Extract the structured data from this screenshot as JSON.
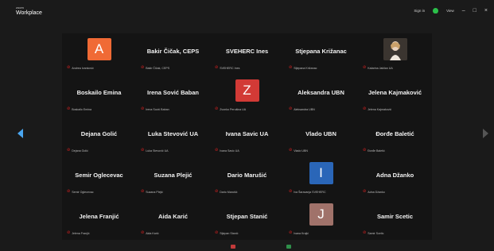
{
  "app": {
    "brand_small": "zoom",
    "brand_title": "Workplace"
  },
  "titlebar": {
    "sign_in_label": "Sign in",
    "view_label": "View",
    "minimize": "–",
    "maximize": "□",
    "close": "×",
    "shield_color": "#2bbf4a"
  },
  "participants": [
    {
      "name": "",
      "initial": "A",
      "avatar_color": "#f06a35",
      "footer": "Andrea Ivanković"
    },
    {
      "name": "Bakir Čičak, CEPS",
      "footer": "Bakir Čičak, CEPS"
    },
    {
      "name": "SVEHERC Ines",
      "footer": "SVEHERC Ines"
    },
    {
      "name": "Stjepana Križanac",
      "footer": "Stjepana Križanac"
    },
    {
      "name": "",
      "photo": true,
      "footer": "Katarina Jaklian UA"
    },
    {
      "name": "Boskailo Emina",
      "footer": "Boskailo Emina"
    },
    {
      "name": "Irena Sović Baban",
      "footer": "Irena Sović Baban"
    },
    {
      "name": "",
      "initial": "Z",
      "avatar_color": "#d23a36",
      "footer": "Zvonko Perušina UA"
    },
    {
      "name": "Aleksandra UBN",
      "footer": "Aleksandra UBN"
    },
    {
      "name": "Jelena Kajmaković",
      "footer": "Jelena Kajmaković"
    },
    {
      "name": "Dejana Golić",
      "footer": "Dejana Golić"
    },
    {
      "name": "Luka Stevović UA",
      "footer": "Luka Stevović UA"
    },
    {
      "name": "Ivana Savic UA",
      "footer": "Ivana Savic UA"
    },
    {
      "name": "Vlado UBN",
      "footer": "Vlado UBN"
    },
    {
      "name": "Đorđe Baletić",
      "footer": "Đorđe Baletić"
    },
    {
      "name": "Semir Oglecevac",
      "footer": "Semir Oglecevac"
    },
    {
      "name": "Suzana Plejić",
      "footer": "Suzana Plejić"
    },
    {
      "name": "Dario Marušić",
      "footer": "Dario Marušić"
    },
    {
      "name": "",
      "initial": "I",
      "avatar_color": "#2a66b8",
      "footer": "Iva Šaravanja SVEHERC"
    },
    {
      "name": "Adna Džanko",
      "footer": "Adna Džanko"
    },
    {
      "name": "Jelena Franjić",
      "footer": "Jelena Franjić"
    },
    {
      "name": "Aida Karić",
      "footer": "Aida Karić"
    },
    {
      "name": "Stjepan Stanić",
      "footer": "Stjepan Stanić"
    },
    {
      "name": "",
      "initial": "J",
      "avatar_color": "#a0726a",
      "footer": "Ivana Krajić"
    },
    {
      "name": "Samir Scetic",
      "footer": "Samir Scetic"
    }
  ]
}
